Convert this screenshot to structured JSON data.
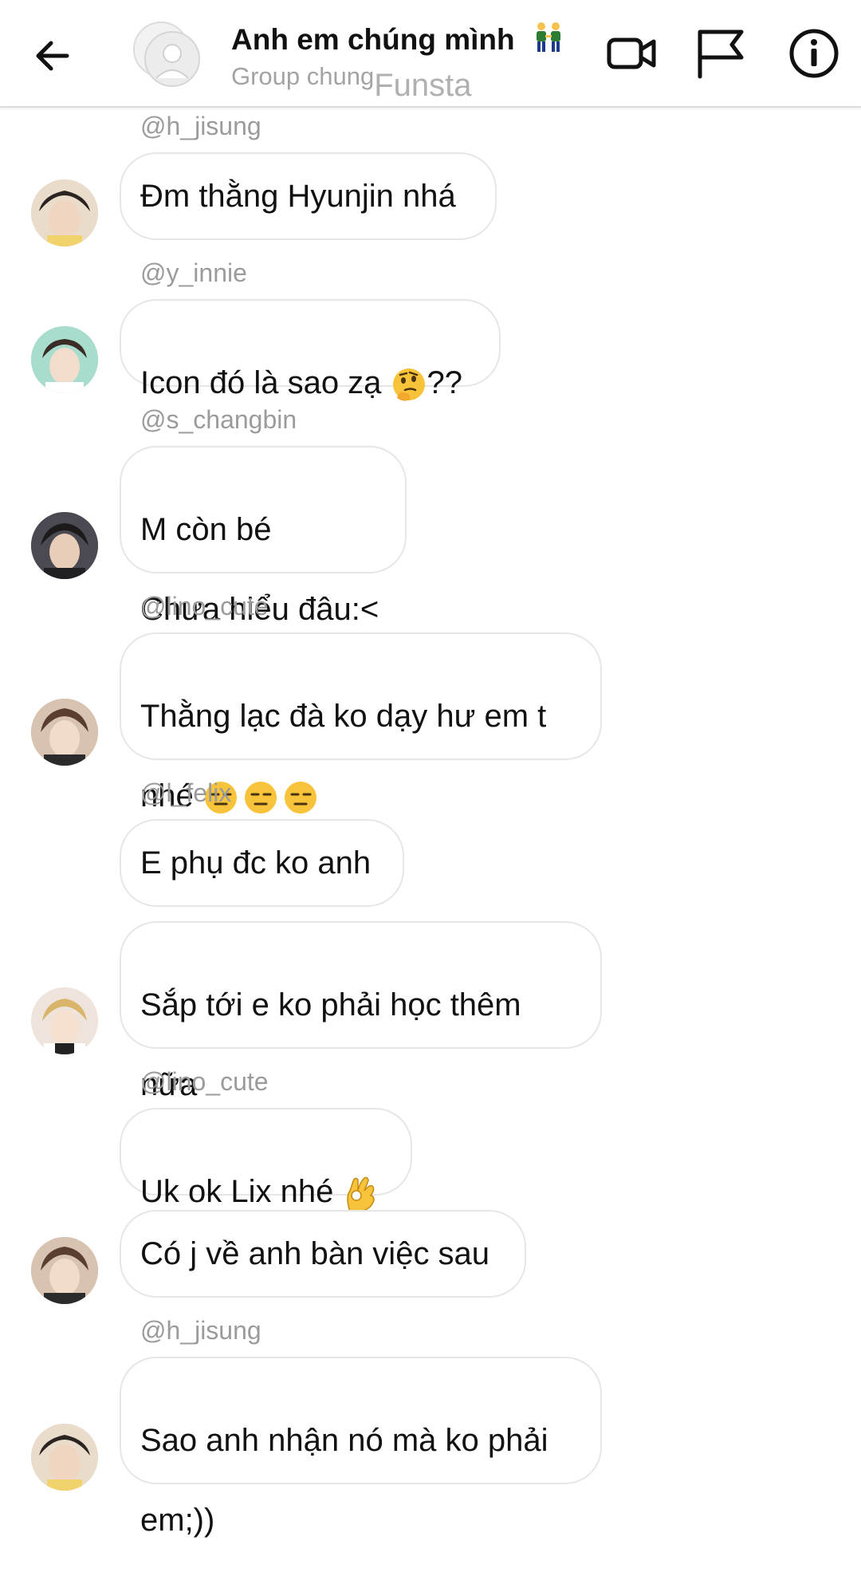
{
  "header": {
    "title": "Anh em chúng mình",
    "title_emoji": "two-men-holding-hands",
    "subtitle": "Group chung",
    "subtitle_tag": "Funsta",
    "icons": [
      "back-arrow-icon",
      "group-avatar-icon",
      "video-call-icon",
      "flag-icon",
      "info-icon"
    ]
  },
  "messages": [
    {
      "handle": "@h_jisung",
      "text": "Đm thằng Hyunjin nhá",
      "avatar_color": "#d9c7b0"
    },
    {
      "handle": "@y_innie",
      "text": "Icon đó là sao zạ ",
      "text_after_emoji": "??",
      "emoji": "thinking-face",
      "avatar_color": "#9fd3c4"
    },
    {
      "handle": "@s_changbin",
      "lines": [
        "M còn bé",
        "Chưa hiểu đâu:<"
      ],
      "avatar_color": "#5b5b63"
    },
    {
      "handle": "@lino_cute",
      "lines": [
        "Thằng lạc đà ko dạy hư em t",
        "nhé "
      ],
      "emoji": "expressionless-face x3",
      "avatar_color": "#c9a98f"
    },
    {
      "handle": "@l_felix",
      "text": "E phụ đc ko anh",
      "avatar_color": "#e8d3c2"
    },
    {
      "lines": [
        "Sắp tới e ko phải học thêm",
        "nữa"
      ]
    },
    {
      "handle": "@lino_cute",
      "text": "Uk ok Lix nhé ",
      "emoji": "ok-hand",
      "avatar_color": "#c9a98f"
    },
    {
      "text": "Có j về anh bàn việc sau"
    },
    {
      "handle": "@h_jisung",
      "lines": [
        "Sao anh nhận nó mà ko phải",
        "em;))"
      ],
      "avatar_color": "#d9c7b0"
    }
  ]
}
